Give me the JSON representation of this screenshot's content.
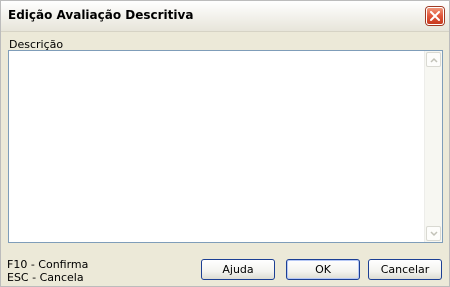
{
  "window": {
    "title": "Edição Avaliação Descritiva"
  },
  "form": {
    "description_label": "Descrição",
    "description_value": ""
  },
  "hints": {
    "confirm": "F10 - Confirma",
    "cancel": "ESC - Cancela"
  },
  "buttons": {
    "help": "Ajuda",
    "ok": "OK",
    "cancel": "Cancelar"
  },
  "icons": {
    "close": "close-icon",
    "scroll_up": "chevron-up-icon",
    "scroll_down": "chevron-down-icon"
  },
  "colors": {
    "close_button": "#e0553a",
    "window_bg": "#ece9d8",
    "button_border": "#1c3f94"
  }
}
